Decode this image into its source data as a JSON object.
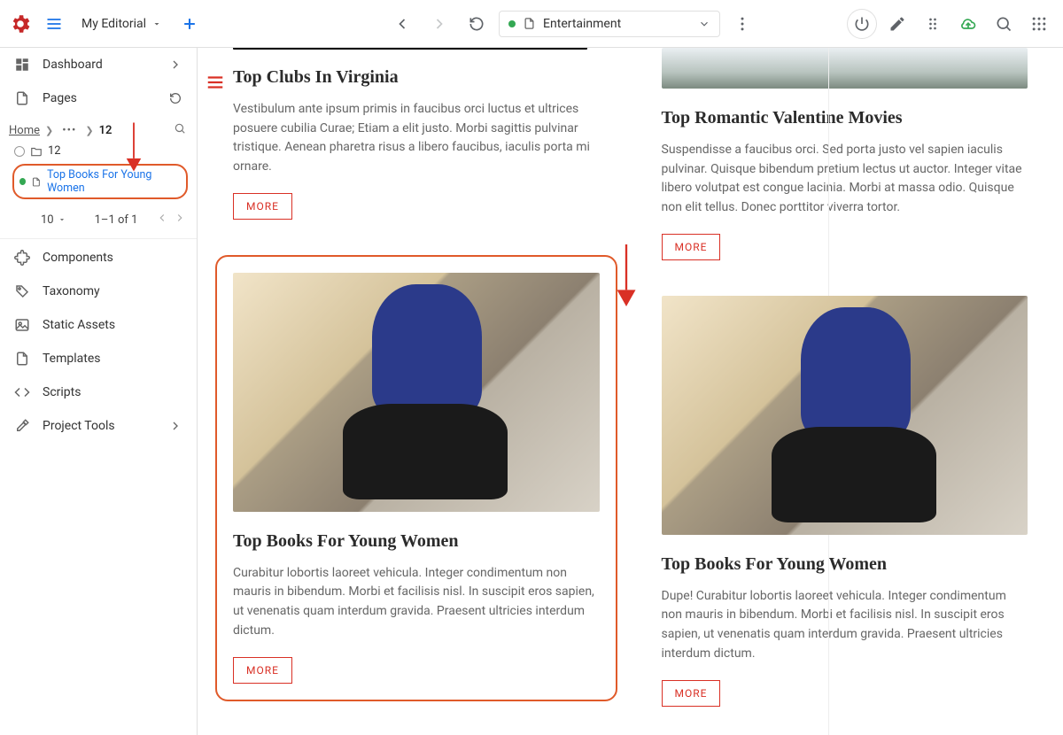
{
  "topbar": {
    "project_name": "My Editorial",
    "context": {
      "label": "Entertainment",
      "status": "live"
    }
  },
  "sidebar": {
    "dashboard": "Dashboard",
    "pages": "Pages",
    "breadcrumb": {
      "home": "Home",
      "current": "12"
    },
    "folder_count": "12",
    "selected_page": "Top Books For Young Women",
    "pager": {
      "per_page": "10",
      "range": "1–1 of 1"
    },
    "components": "Components",
    "taxonomy": "Taxonomy",
    "static_assets": "Static Assets",
    "templates": "Templates",
    "scripts": "Scripts",
    "project_tools": "Project Tools"
  },
  "cards": {
    "clubs": {
      "title": "Top Clubs In Virginia",
      "body": "Vestibulum ante ipsum primis in faucibus orci luctus et ultrices posuere cubilia Curae; Etiam a elit justo. Morbi sagittis pulvinar tristique. Aenean pharetra risus a libero faucibus, iaculis porta mi ornare.",
      "more": "MORE"
    },
    "valentine": {
      "title": "Top Romantic Valentine Movies",
      "body": "Suspendisse a faucibus orci. Sed porta justo vel sapien iaculis pulvinar. Quisque bibendum pretium lectus ut auctor. Integer vitae libero volutpat est congue lacinia. Morbi at massa odio. Quisque non elit tellus. Donec porttitor viverra tortor.",
      "more": "MORE"
    },
    "books_left": {
      "title": "Top Books For Young Women",
      "body": "Curabitur lobortis laoreet vehicula. Integer condimentum non mauris in bibendum. Morbi et facilisis nisl. In suscipit eros sapien, ut venenatis quam interdum gravida. Praesent ultricies interdum dictum.",
      "more": "MORE"
    },
    "books_right": {
      "title": "Top Books For Young Women",
      "body": "Dupe! Curabitur lobortis laoreet vehicula. Integer condimentum non mauris in bibendum. Morbi et facilisis nisl. In suscipit eros sapien, ut venenatis quam interdum gravida. Praesent ultricies interdum dictum.",
      "more": "MORE"
    }
  }
}
